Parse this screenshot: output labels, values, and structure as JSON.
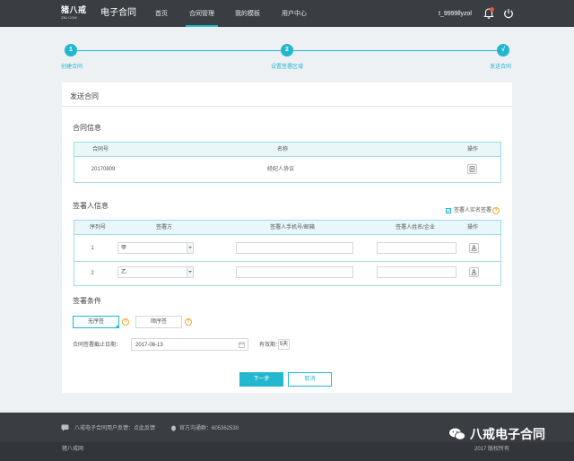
{
  "header": {
    "logo_text": "猪八戒",
    "logo_url": "ZBJ.COM",
    "app_title": "电子合同",
    "nav": [
      "首页",
      "合同管理",
      "我的模板",
      "用户中心"
    ],
    "active_nav": "合同管理",
    "username": "t_9999llyzol",
    "accent_color": "#23b7cf",
    "header_bg": "#3a3d42"
  },
  "steps": [
    {
      "number": "1",
      "label": "创建合同"
    },
    {
      "number": "2",
      "label": "设置签署区域"
    },
    {
      "number": "√",
      "label": "发送合同"
    }
  ],
  "page": {
    "title": "发送合同"
  },
  "contract_info": {
    "title": "合同信息",
    "columns": [
      "合同号",
      "名称",
      "操作"
    ],
    "rows": [
      {
        "number": "20170809",
        "name": "经纪人协议"
      }
    ]
  },
  "signers": {
    "title": "签署人信息",
    "realname_checkbox_label": "签署人实名签署",
    "realname_checked": true,
    "columns": [
      "序列号",
      "签署方",
      "签署人手机号/邮箱",
      "签署人姓名/企业",
      "操作"
    ],
    "rows": [
      {
        "index": "1",
        "party": "甲",
        "contact": "",
        "name": ""
      },
      {
        "index": "2",
        "party": "乙",
        "contact": "",
        "name": ""
      }
    ]
  },
  "conditions": {
    "title": "签署条件",
    "options": [
      "无序签",
      "顺序签"
    ],
    "selected": "无序签",
    "deadline_label": "合同签署截止日期：",
    "deadline_value": "2017-08-13",
    "validity_label": "有效期：",
    "validity_value": "5天"
  },
  "actions": {
    "next_label": "下一步",
    "cancel_label": "取消"
  },
  "footer": {
    "feedback_text": "八戒电子合同用户反馈：点此反馈",
    "qq_group_text": "官方沟通群：605362530",
    "bottom_left": "猪八戒网",
    "bottom_right": "2017 版权所有",
    "watermark_text": "八戒电子合同"
  }
}
